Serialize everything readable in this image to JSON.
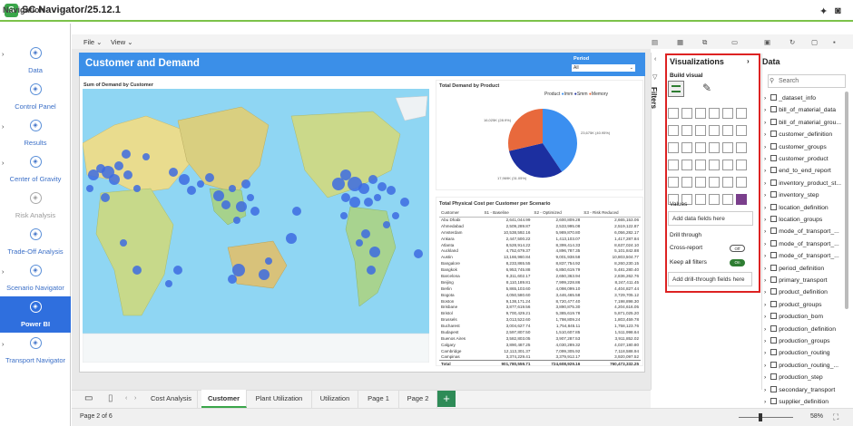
{
  "app": {
    "title": "SC Navigator/25.12.1"
  },
  "nav": {
    "title": "Navigation",
    "items": [
      {
        "label": "Data",
        "icon": "database-icon",
        "arrow": true
      },
      {
        "label": "Control Panel",
        "icon": "control-panel-icon",
        "arrow": false
      },
      {
        "label": "Results",
        "icon": "results-icon",
        "arrow": true
      },
      {
        "label": "Center of Gravity",
        "icon": "center-of-gravity-icon",
        "arrow": true
      },
      {
        "label": "Risk Analysis",
        "icon": "risk-icon",
        "arrow": false
      },
      {
        "label": "Trade-Off Analysis",
        "icon": "tradeoff-icon",
        "arrow": false
      },
      {
        "label": "Scenario Navigator",
        "icon": "scenario-icon",
        "arrow": true
      },
      {
        "label": "Power BI",
        "icon": "powerbi-icon",
        "arrow": false
      },
      {
        "label": "Transport Navigator",
        "icon": "transport-icon",
        "arrow": true
      }
    ]
  },
  "toolbar": {
    "file": "File",
    "view": "View"
  },
  "report": {
    "title": "Customer and Demand",
    "period_label": "Period",
    "period_value": "All",
    "map_title": "Sum of Demand by Customer",
    "pie_title": "Total Demand by Product",
    "pie_legend_label": "Product",
    "pie_legend": [
      "Imm",
      "Smm",
      "Memory"
    ],
    "pie_labels": [
      "16,025K (28.9%)",
      "23,675K (40.95%)",
      "17,969K (31.05%)"
    ],
    "table_title": "Total Physical Cost per Customer per Scenario",
    "table_headers": [
      "Customer",
      "S1 - Baseline",
      "S2 - Optimized",
      "S3 - Risk Reduced"
    ],
    "table_rows": [
      [
        "Abu Dhabi",
        "2,641,044.99",
        "2,600,809.28",
        "2,665,153.06"
      ],
      [
        "Ahmedabad",
        "2,509,289.87",
        "2,533,995.08",
        "2,519,122.87"
      ],
      [
        "Amsterdam",
        "10,538,592.16",
        "5,989,870.80",
        "6,056,282.17"
      ],
      [
        "Ankara",
        "2,447,500.22",
        "1,413,103.07",
        "1,417,287.84"
      ],
      [
        "Atlanta",
        "8,528,914.22",
        "8,399,414.33",
        "8,637,024.10"
      ],
      [
        "Auckland",
        "4,752,679.37",
        "4,896,787.35",
        "5,101,842.88"
      ],
      [
        "Austin",
        "13,166,960.84",
        "9,001,938.58",
        "10,803,504.77"
      ],
      [
        "Bangalore",
        "8,233,865.55",
        "8,837,754.92",
        "8,260,230.15"
      ],
      [
        "Bangkok",
        "6,953,745.88",
        "6,850,619.79",
        "5,481,280.40"
      ],
      [
        "Barcelona",
        "6,311,602.17",
        "2,650,363.94",
        "2,836,262.76"
      ],
      [
        "Beijing",
        "8,110,189.81",
        "7,999,228.86",
        "8,247,411.45"
      ],
      [
        "Berlin",
        "5,865,103.60",
        "4,098,099.10",
        "4,404,827.44"
      ],
      [
        "Bogota",
        "4,050,580.60",
        "3,446,465.58",
        "3,729,705.12"
      ],
      [
        "Boston",
        "9,138,171.24",
        "8,720,477.40",
        "7,198,898.30"
      ],
      [
        "Brisbane",
        "3,877,619.56",
        "3,890,875.30",
        "4,204,616.05"
      ],
      [
        "Bristol",
        "9,700,429.21",
        "5,385,619.78",
        "5,871,025.20"
      ],
      [
        "Brussels",
        "3,013,522.60",
        "1,798,809.24",
        "1,803,459.78"
      ],
      [
        "Bucharest",
        "3,004,627.74",
        "1,754,845.11",
        "1,758,123.76"
      ],
      [
        "Budapest",
        "2,597,807.50",
        "1,510,607.85",
        "1,511,998.64"
      ],
      [
        "Buenos Aires",
        "3,582,803.05",
        "3,907,287.53",
        "3,911,852.02"
      ],
      [
        "Calgary",
        "3,890,487.25",
        "4,030,289.32",
        "4,037,180.80"
      ],
      [
        "Cambridge",
        "12,113,301.37",
        "7,099,305.92",
        "7,118,588.94"
      ],
      [
        "Campinas",
        "3,374,229.41",
        "3,379,912.17",
        "3,920,097.52"
      ]
    ],
    "table_total": [
      "Total",
      "901,780,559.71",
      "724,608,929.16",
      "760,473,332.25"
    ]
  },
  "pages": {
    "tabs": [
      "Cost Analysis",
      "Customer",
      "Plant Utilization",
      "Utilization",
      "Page 1",
      "Page 2"
    ],
    "active": "Customer",
    "add_label": "+",
    "page_count": "Page 2 of 6",
    "zoom": "58%"
  },
  "filters": {
    "label": "Filters"
  },
  "viz": {
    "title": "Visualizations",
    "build_label": "Build visual",
    "values_label": "Values",
    "values_placeholder": "Add data fields here",
    "drill_label": "Drill through",
    "cross_report_label": "Cross-report",
    "cross_report_state": "Off",
    "keep_filters_label": "Keep all filters",
    "keep_filters_state": "On",
    "drill_placeholder": "Add drill-through fields here"
  },
  "datapane": {
    "title": "Data",
    "search_placeholder": "Search",
    "items": [
      "_dataset_info",
      "bill_of_material_data",
      "bill_of_material_grou...",
      "customer_definition",
      "customer_groups",
      "customer_product",
      "end_to_end_report",
      "inventory_product_st...",
      "inventory_step",
      "location_definition",
      "location_groups",
      "mode_of_transport_...",
      "mode_of_transport_...",
      "mode_of_transport_...",
      "period_definition",
      "primary_transport",
      "product_definition",
      "product_groups",
      "production_bom",
      "production_definition",
      "production_groups",
      "production_routing",
      "production_routing_...",
      "production_step",
      "secondary_transport",
      "supplier_definition"
    ]
  },
  "colors": {
    "accent": "#3b8fe8",
    "nav_active": "#2f6fde",
    "brand_green": "#3aa64a",
    "highlight_border": "#dd2222",
    "pie_imm": "#3b8ff0",
    "pie_smm": "#1c2fa0",
    "pie_memory": "#e8693c"
  }
}
